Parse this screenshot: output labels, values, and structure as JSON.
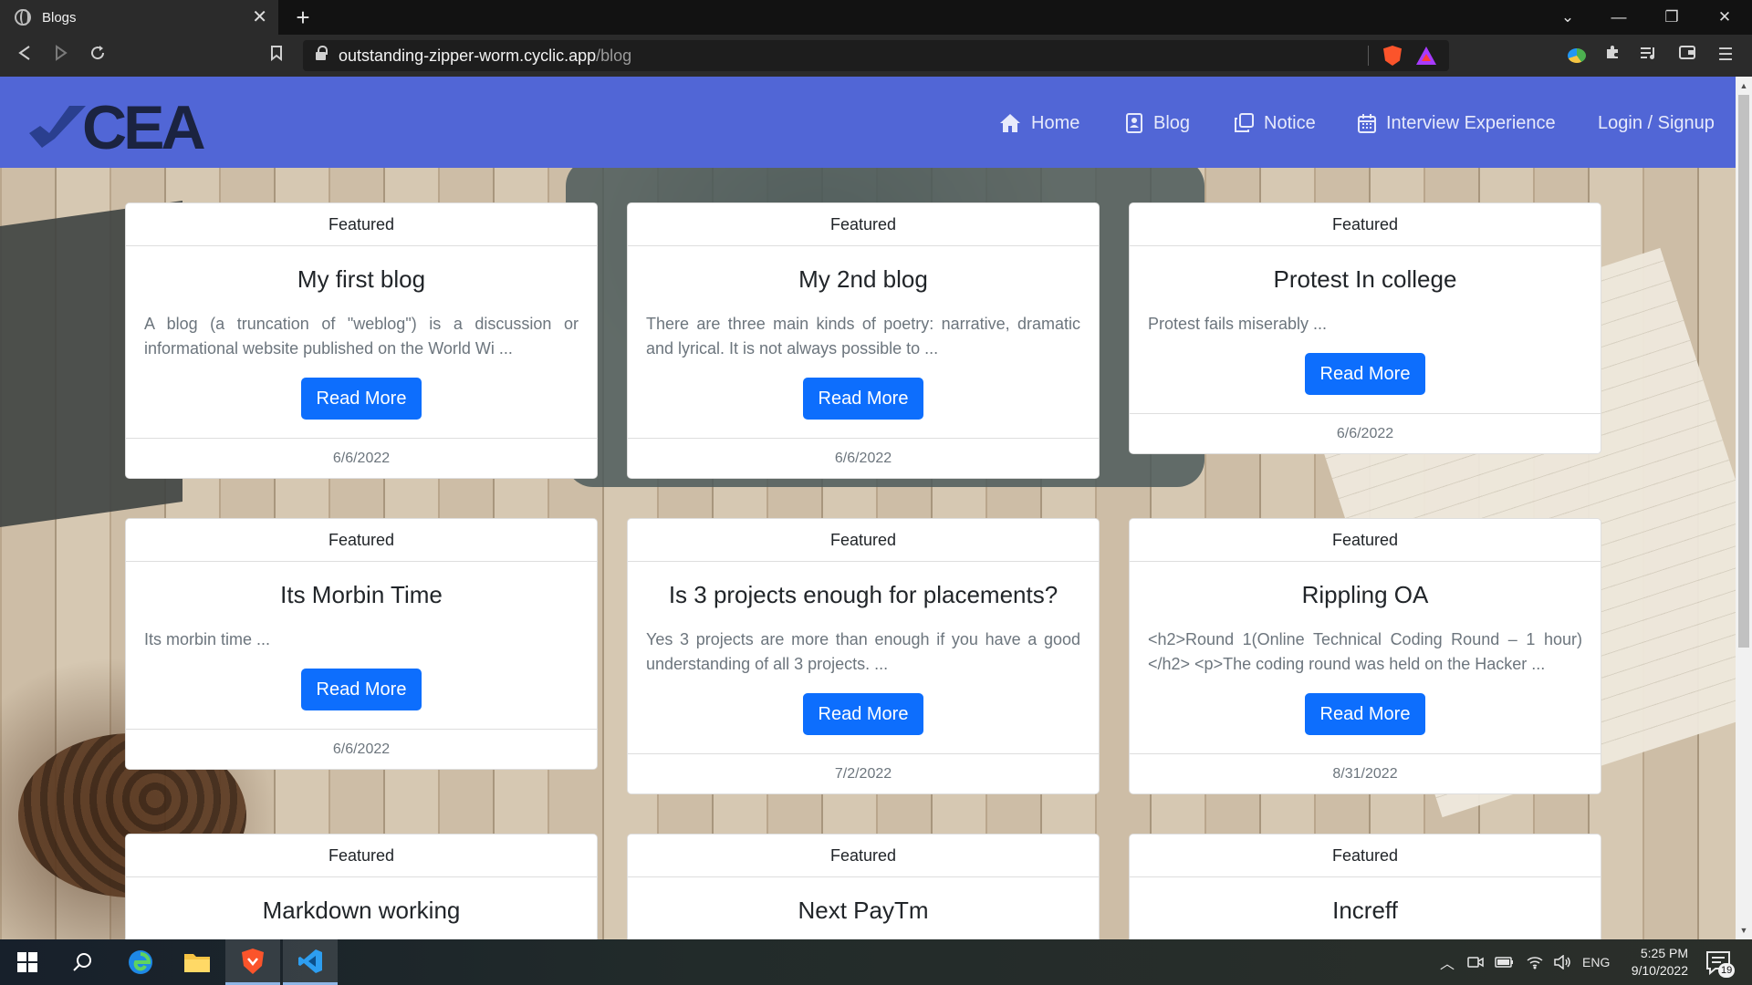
{
  "browser": {
    "tab_title": "Blogs",
    "url_host": "outstanding-zipper-worm.cyclic.app",
    "url_path": "/blog"
  },
  "site": {
    "logo_text": "CEA",
    "nav": [
      {
        "label": "Home",
        "icon": "home-icon"
      },
      {
        "label": "Blog",
        "icon": "blog-icon"
      },
      {
        "label": "Notice",
        "icon": "notice-icon"
      },
      {
        "label": "Interview Experience",
        "icon": "calendar-icon"
      },
      {
        "label": "Login / Signup",
        "icon": ""
      }
    ]
  },
  "blogs": [
    {
      "header": "Featured",
      "title": "My first blog",
      "excerpt": "A blog (a truncation of \"weblog\") is a discussion or informational website published on the World Wi ...",
      "button": "Read More",
      "date": "6/6/2022"
    },
    {
      "header": "Featured",
      "title": "My 2nd blog",
      "excerpt": "There are three main kinds of poetry: narrative, dramatic and lyrical. It is not always possible to ...",
      "button": "Read More",
      "date": "6/6/2022"
    },
    {
      "header": "Featured",
      "title": "Protest In college",
      "excerpt": "Protest fails miserably ...",
      "button": "Read More",
      "date": "6/6/2022"
    },
    {
      "header": "Featured",
      "title": "Its Morbin Time",
      "excerpt": "Its morbin time ...",
      "button": "Read More",
      "date": "6/6/2022"
    },
    {
      "header": "Featured",
      "title": "Is 3 projects enough for placements?",
      "excerpt": "Yes 3 projects are more than enough if you have a good understanding of all 3 projects. ...",
      "button": "Read More",
      "date": "7/2/2022"
    },
    {
      "header": "Featured",
      "title": "Rippling OA",
      "excerpt": "<h2>Round 1(Online Technical Coding Round – 1 hour)</h2> <p>The coding round was held on the Hacker ...",
      "button": "Read More",
      "date": "8/31/2022"
    },
    {
      "header": "Featured",
      "title": "Markdown working"
    },
    {
      "header": "Featured",
      "title": "Next PayTm"
    },
    {
      "header": "Featured",
      "title": "Increff"
    }
  ],
  "taskbar": {
    "language": "ENG",
    "time": "5:25 PM",
    "date": "9/10/2022",
    "notification_count": "19"
  },
  "colors": {
    "navbar": "#5166d6",
    "button": "#0d6efd",
    "browser_chrome": "#2b2b2b"
  }
}
